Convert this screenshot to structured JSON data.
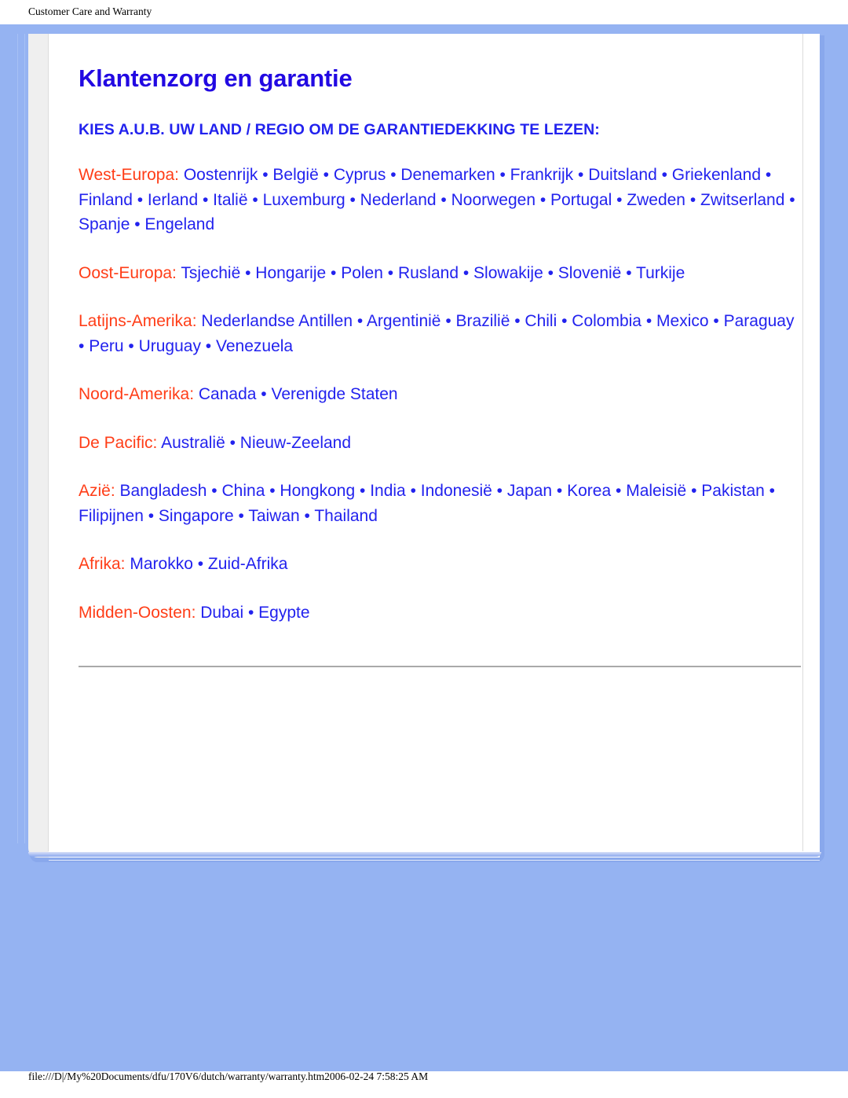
{
  "print_header": "Customer Care and Warranty",
  "print_footer": "file:///D|/My%20Documents/dfu/170V6/dutch/warranty/warranty.htm2006-02-24 7:58:25 AM",
  "document": {
    "title": "Klantenzorg en garantie",
    "subheading": "KIES A.U.B. UW LAND / REGIO OM DE GARANTIEDEKKING TE LEZEN:",
    "separator": "•",
    "regions": [
      {
        "label": "West-Europa:",
        "countries": [
          "Oostenrijk",
          "België",
          "Cyprus",
          "Denemarken",
          "Frankrijk",
          "Duitsland",
          "Griekenland",
          "Finland",
          "Ierland",
          "Italië",
          "Luxemburg",
          "Nederland",
          "Noorwegen",
          "Portugal",
          "Zweden",
          "Zwitserland",
          "Spanje",
          "Engeland"
        ]
      },
      {
        "label": "Oost-Europa:",
        "countries": [
          "Tsjechië",
          "Hongarije",
          "Polen",
          "Rusland",
          "Slowakije",
          "Slovenië",
          "Turkije"
        ]
      },
      {
        "label": "Latijns-Amerika:",
        "countries": [
          "Nederlandse Antillen",
          "Argentinië",
          "Brazilië",
          "Chili",
          "Colombia",
          "Mexico",
          "Paraguay",
          "Peru",
          "Uruguay",
          "Venezuela"
        ]
      },
      {
        "label": "Noord-Amerika:",
        "countries": [
          "Canada",
          "Verenigde Staten"
        ]
      },
      {
        "label": "De Pacific:",
        "countries": [
          "Australië",
          "Nieuw-Zeeland"
        ]
      },
      {
        "label": "Azië:",
        "countries": [
          "Bangladesh",
          "China",
          "Hongkong",
          "India",
          "Indonesië",
          "Japan",
          "Korea",
          "Maleisië",
          "Pakistan",
          "Filipijnen",
          "Singapore",
          "Taiwan",
          "Thailand"
        ]
      },
      {
        "label": "Afrika:",
        "countries": [
          "Marokko",
          "Zuid-Afrika"
        ]
      },
      {
        "label": "Midden-Oosten:",
        "countries": [
          "Dubai",
          "Egypte"
        ]
      }
    ]
  },
  "colors": {
    "page_background": "#95b3f2",
    "title": "#2209e2",
    "link": "#2222ee",
    "region_label": "#ff3d17",
    "rule": "#a9a9a9",
    "card": "#ffffff",
    "card_frame": "#efefef"
  }
}
